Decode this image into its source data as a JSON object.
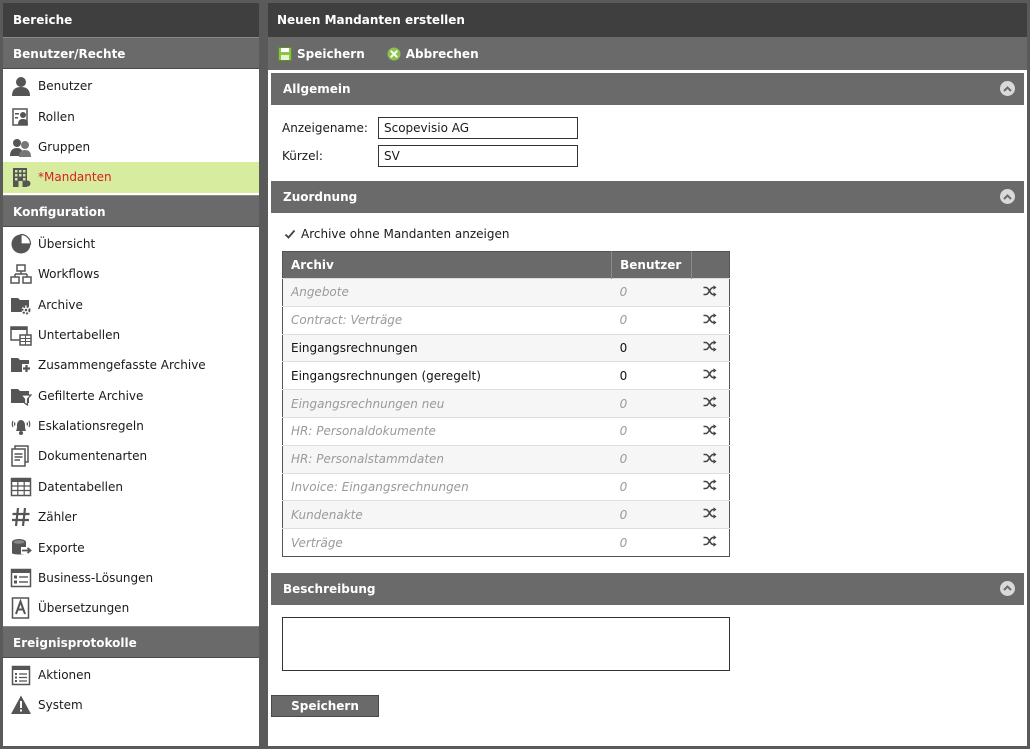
{
  "sidebar": {
    "title": "Bereiche",
    "groups": [
      {
        "label": "Benutzer/Rechte",
        "items": [
          {
            "label": "Benutzer",
            "icon": "user-icon"
          },
          {
            "label": "Rollen",
            "icon": "roles-icon"
          },
          {
            "label": "Gruppen",
            "icon": "group-icon"
          },
          {
            "label": "*Mandanten",
            "icon": "building-icon",
            "active": true
          }
        ]
      },
      {
        "label": "Konfiguration",
        "items": [
          {
            "label": "Übersicht",
            "icon": "pie-chart-icon"
          },
          {
            "label": "Workflows",
            "icon": "workflow-icon"
          },
          {
            "label": "Archive",
            "icon": "archive-settings-icon"
          },
          {
            "label": "Untertabellen",
            "icon": "subtable-icon"
          },
          {
            "label": "Zusammengefasste Archive",
            "icon": "merged-archive-icon"
          },
          {
            "label": "Gefilterte Archive",
            "icon": "filtered-archive-icon"
          },
          {
            "label": "Eskalationsregeln",
            "icon": "alarm-bell-icon"
          },
          {
            "label": "Dokumentenarten",
            "icon": "document-types-icon"
          },
          {
            "label": "Datentabellen",
            "icon": "data-table-icon"
          },
          {
            "label": "Zähler",
            "icon": "hash-icon"
          },
          {
            "label": "Exporte",
            "icon": "export-icon"
          },
          {
            "label": "Business-Lösungen",
            "icon": "business-solutions-icon"
          },
          {
            "label": "Übersetzungen",
            "icon": "translation-icon"
          }
        ]
      },
      {
        "label": "Ereignisprotokolle",
        "items": [
          {
            "label": "Aktionen",
            "icon": "actions-log-icon"
          },
          {
            "label": "System",
            "icon": "warning-icon"
          }
        ]
      }
    ]
  },
  "main": {
    "title": "Neuen Mandanten erstellen",
    "toolbar": {
      "save_label": "Speichern",
      "cancel_label": "Abbrechen"
    },
    "general": {
      "title": "Allgemein",
      "display_name_label": "Anzeigename:",
      "display_name_value": "Scopevisio AG",
      "short_label": "Kürzel:",
      "short_value": "SV"
    },
    "assignment": {
      "title": "Zuordnung",
      "checkbox_label": "Archive ohne Mandanten anzeigen",
      "checkbox_checked": true,
      "columns": [
        "Archiv",
        "Benutzer"
      ],
      "rows": [
        {
          "name": "Angebote",
          "users": "0",
          "active": false
        },
        {
          "name": "Contract: Verträge",
          "users": "0",
          "active": false
        },
        {
          "name": "Eingangsrechnungen",
          "users": "0",
          "active": true
        },
        {
          "name": "Eingangsrechnungen (geregelt)",
          "users": "0",
          "active": true
        },
        {
          "name": "Eingangsrechnungen neu",
          "users": "0",
          "active": false
        },
        {
          "name": "HR: Personaldokumente",
          "users": "0",
          "active": false
        },
        {
          "name": "HR: Personalstammdaten",
          "users": "0",
          "active": false
        },
        {
          "name": "Invoice: Eingangsrechnungen",
          "users": "0",
          "active": false
        },
        {
          "name": "Kundenakte",
          "users": "0",
          "active": false
        },
        {
          "name": "Verträge",
          "users": "0",
          "active": false
        }
      ]
    },
    "description": {
      "title": "Beschreibung",
      "value": ""
    },
    "save_button_label": "Speichern"
  },
  "colors": {
    "accent_green": "#8bc34a",
    "active_bg": "#d8eca0",
    "active_text": "#d6201f",
    "header_dark": "#3f3f3f",
    "header_mid": "#6a6a6a"
  }
}
